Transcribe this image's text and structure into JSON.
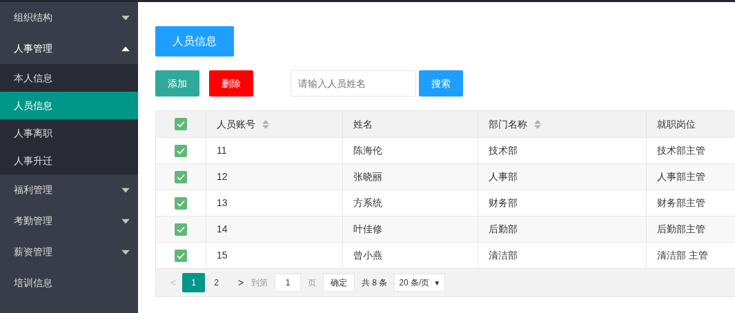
{
  "sidebar": {
    "items": [
      {
        "label": "组织结构",
        "kind": "group",
        "expanded": false
      },
      {
        "label": "人事管理",
        "kind": "group",
        "expanded": true,
        "children": [
          {
            "label": "本人信息",
            "selected": false
          },
          {
            "label": "人员信息",
            "selected": true
          },
          {
            "label": "人事离职",
            "selected": false
          },
          {
            "label": "人事升迁",
            "selected": false
          }
        ]
      },
      {
        "label": "福利管理",
        "kind": "group",
        "expanded": false
      },
      {
        "label": "考勤管理",
        "kind": "group",
        "expanded": false
      },
      {
        "label": "薪资管理",
        "kind": "group",
        "expanded": false
      },
      {
        "label": "培训信息",
        "kind": "link"
      }
    ]
  },
  "page_title": "人员信息",
  "toolbar": {
    "add": "添加",
    "delete": "删除",
    "search": {
      "placeholder": "请输入人员姓名"
    },
    "search_button": "搜索"
  },
  "table": {
    "all_checked": true,
    "columns": [
      {
        "label": "人员账号",
        "sortable": true
      },
      {
        "label": "姓名",
        "sortable": false
      },
      {
        "label": "部门名称",
        "sortable": true
      },
      {
        "label": "就职岗位",
        "sortable": false
      }
    ],
    "rows": [
      {
        "checked": true,
        "cells": [
          "11",
          "陈海伦",
          "技术部",
          "技术部主管"
        ]
      },
      {
        "checked": true,
        "cells": [
          "12",
          "张晓丽",
          "人事部",
          "人事部主管"
        ]
      },
      {
        "checked": true,
        "cells": [
          "13",
          "方系统",
          "财务部",
          "财务部主管"
        ]
      },
      {
        "checked": true,
        "cells": [
          "14",
          "叶佳修",
          "后勤部",
          "后勤部主管"
        ]
      },
      {
        "checked": true,
        "cells": [
          "15",
          "曾小燕",
          "清洁部",
          "清洁部 主管"
        ]
      }
    ]
  },
  "pager": {
    "prev": "<",
    "pages": [
      {
        "label": "1",
        "selected": true
      },
      {
        "label": "2",
        "selected": false
      }
    ],
    "next": ">",
    "goto_label": "到第",
    "goto_value": "1",
    "page_unit": "页",
    "confirm": "确定",
    "total": "共 8 条",
    "page_size": "20 条/页",
    "page_size_caret": "▼"
  }
}
